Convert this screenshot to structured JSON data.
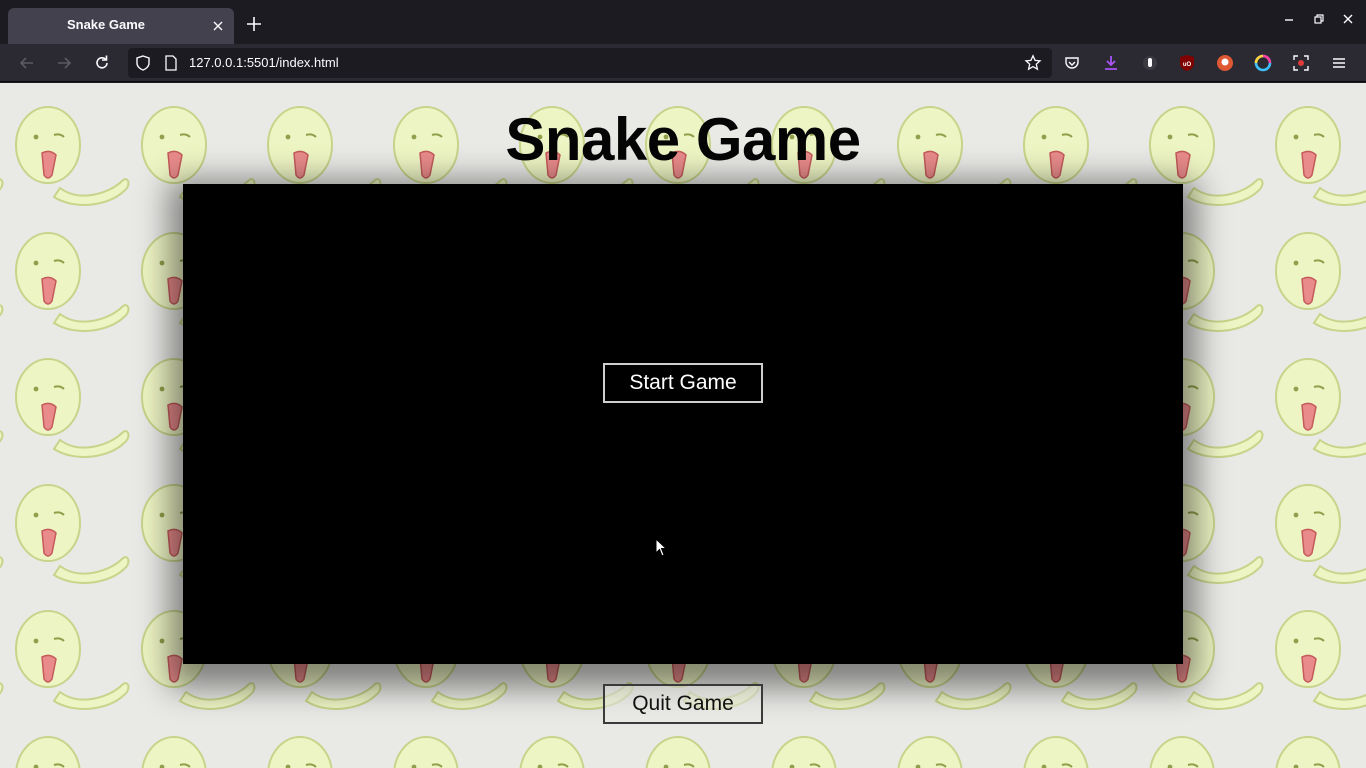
{
  "browser": {
    "tab_title": "Snake Game",
    "url": "127.0.0.1:5501/index.html"
  },
  "page": {
    "heading": "Snake Game",
    "start_button": "Start Game",
    "quit_button": "Quit Game"
  },
  "colors": {
    "board": "#000000",
    "snake_pattern_fill": "#eef5c4",
    "snake_pattern_outline": "#c7d48a",
    "snake_tongue": "#e98b8b"
  },
  "icons": {
    "nav": [
      "back-icon",
      "forward-icon",
      "reload-icon"
    ],
    "urlbar": [
      "shield-icon",
      "page-icon",
      "star-icon"
    ],
    "extensions": [
      "pocket-icon",
      "download-icon",
      "extension-icon",
      "ublock-icon",
      "duckduckgo-icon",
      "color-picker-icon",
      "screenshot-icon",
      "menu-icon"
    ]
  }
}
